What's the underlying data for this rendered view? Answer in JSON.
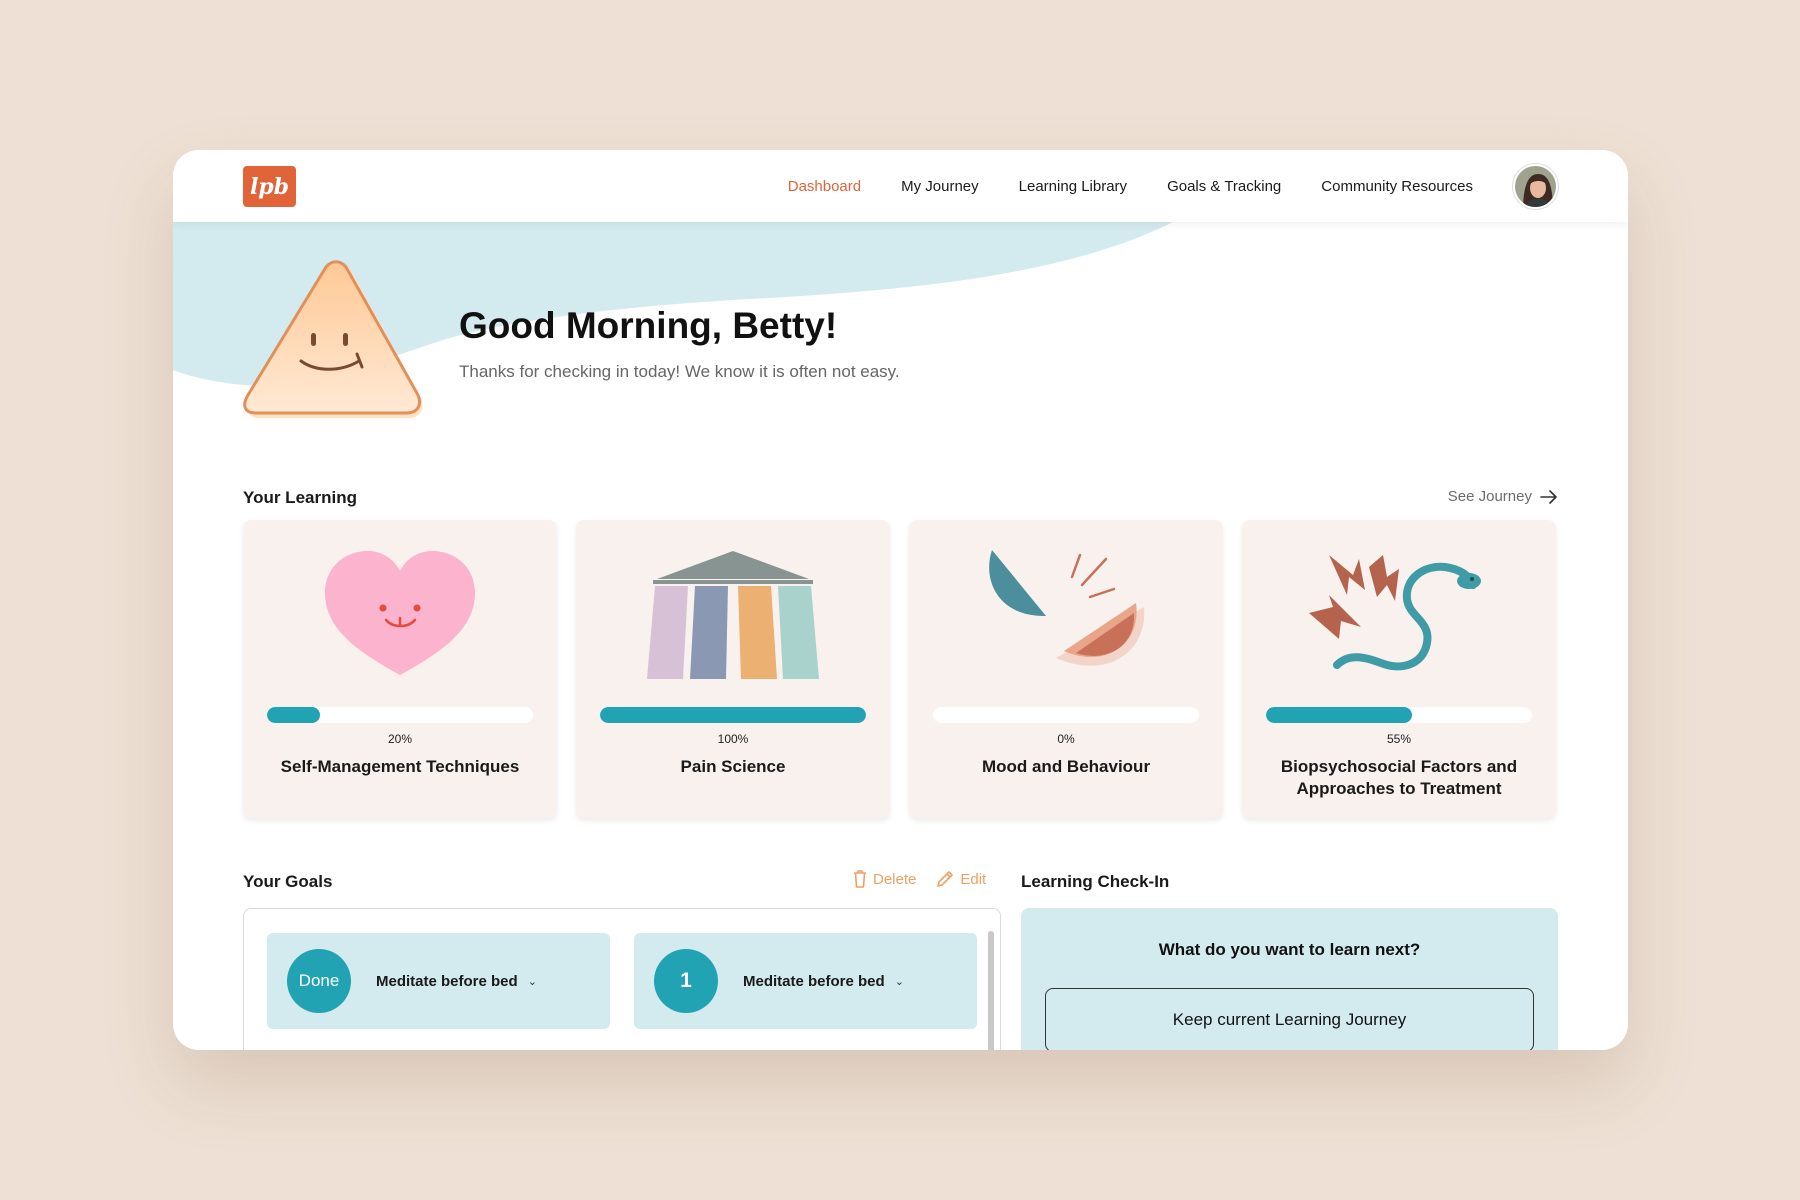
{
  "header": {
    "logo_text": "lpb",
    "nav": [
      {
        "label": "Dashboard",
        "active": true
      },
      {
        "label": "My Journey",
        "active": false
      },
      {
        "label": "Learning Library",
        "active": false
      },
      {
        "label": "Goals & Tracking",
        "active": false
      },
      {
        "label": "Community Resources",
        "active": false
      }
    ],
    "avatar_icon": "user-avatar"
  },
  "hero": {
    "greeting": "Good Morning, Betty!",
    "subtitle": "Thanks for checking in today! We know it is often not easy."
  },
  "learning": {
    "title": "Your Learning",
    "see_journey": "See Journey",
    "cards": [
      {
        "title": "Self-Management Techniques",
        "progress": 20,
        "progress_label": "20%",
        "icon": "heart-icon"
      },
      {
        "title": "Pain Science",
        "progress": 100,
        "progress_label": "100%",
        "icon": "pillars-icon"
      },
      {
        "title": "Mood and Behaviour",
        "progress": 0,
        "progress_label": "0%",
        "icon": "broken-bowl-icon"
      },
      {
        "title": "Biopsychosocial Factors and Approaches to Treatment",
        "progress": 55,
        "progress_label": "55%",
        "icon": "snake-icon"
      }
    ]
  },
  "goals": {
    "title": "Your Goals",
    "delete_label": "Delete",
    "edit_label": "Edit",
    "items": [
      {
        "badge": "Done",
        "label": "Meditate before bed"
      },
      {
        "badge": "1",
        "label": "Meditate before bed"
      }
    ]
  },
  "checkin": {
    "title": "Learning Check-In",
    "question": "What do you want to learn next?",
    "button": "Keep current Learning Journey"
  },
  "colors": {
    "accent": "#E06437",
    "teal": "#22A3B4",
    "goal_action": "#F0A060",
    "background": "#EEE0D4"
  }
}
